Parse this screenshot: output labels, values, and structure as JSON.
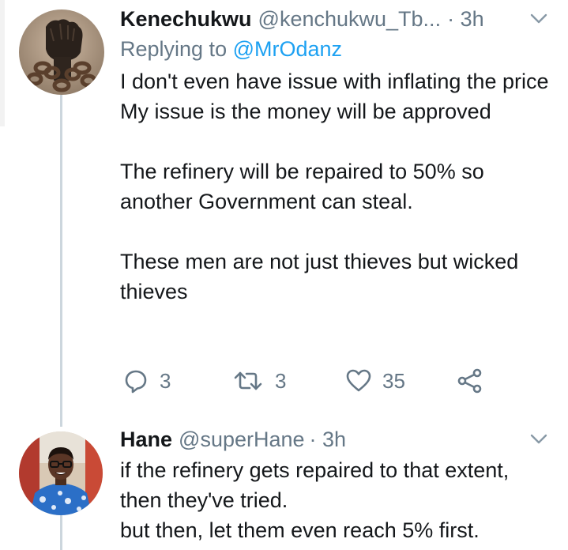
{
  "tweets": [
    {
      "display_name": "Kenechukwu",
      "handle": "@kenchukwu_Tb...",
      "time": "· 3h",
      "replying_prefix": "Replying to ",
      "replying_to": "@MrOdanz",
      "text": "I don't even have issue with inflating the price\nMy issue is the money will be approved\n\nThe refinery will be repaired to 50% so another Government can steal.\n\nThese men are not just thieves but wicked thieves",
      "actions": {
        "reply_count": "3",
        "retweet_count": "3",
        "like_count": "35"
      }
    },
    {
      "display_name": "Hane",
      "handle": "@superHane",
      "time": "· 3h",
      "text": "if the refinery gets repaired to that extent,  then they've tried.\nbut then, let them even reach 5% first."
    }
  ],
  "icons": {
    "reply": "reply-icon",
    "retweet": "retweet-icon",
    "like": "heart-icon",
    "share": "share-icon",
    "menu": "chevron-down-icon"
  },
  "colors": {
    "text": "#14171a",
    "secondary": "#657786",
    "accent": "#1da1f2",
    "thread_line": "#ccd6dd"
  }
}
